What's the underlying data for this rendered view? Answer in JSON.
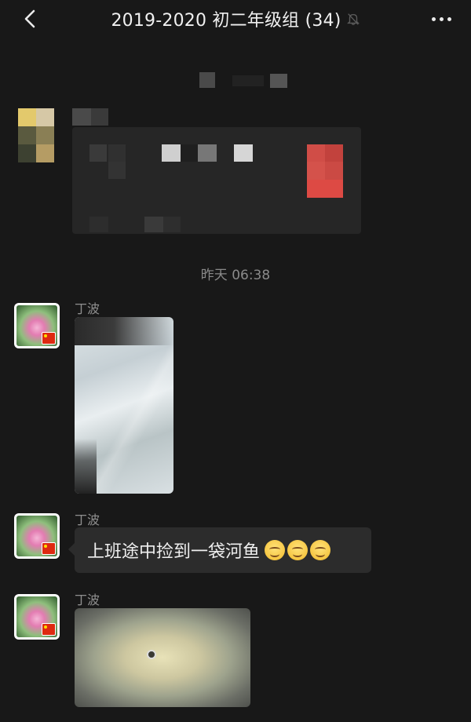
{
  "header": {
    "title": "2019-2020 初二年级组 (34)",
    "back_icon": "chevron-left-icon",
    "mute_icon": "bell-off-icon",
    "more_icon": "more-dots-icon"
  },
  "timestamps": {
    "middle": "昨天 06:38"
  },
  "messages": [
    {
      "sender": "丁波",
      "type": "image"
    },
    {
      "sender": "丁波",
      "type": "text",
      "text": "上班途中捡到一袋河鱼"
    },
    {
      "sender": "丁波",
      "type": "image"
    }
  ],
  "colors": {
    "background": "#181818",
    "bubble": "#2c2c2c",
    "name": "#8f8f8f"
  }
}
